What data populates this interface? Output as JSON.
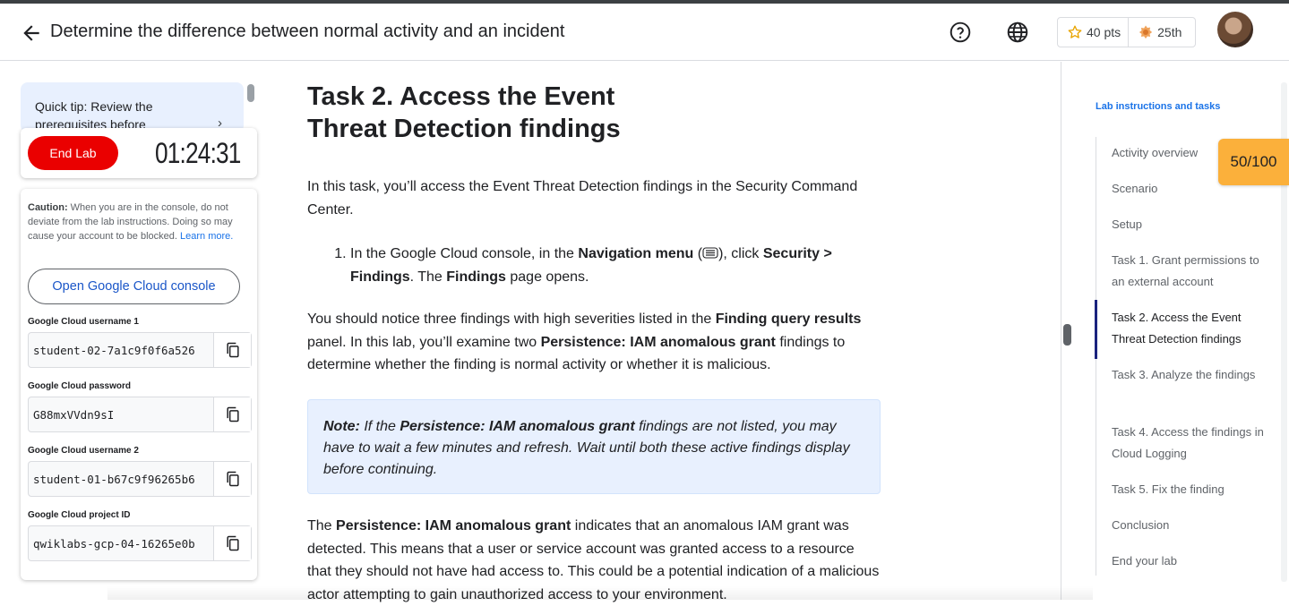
{
  "header": {
    "title": "Determine the difference between normal activity and an incident",
    "points": "40 pts",
    "rank": "25th"
  },
  "left": {
    "tip": "Quick tip: Review the prerequisites before",
    "end_lab": "End Lab",
    "timer": "01:24:31",
    "caution_label": "Caution:",
    "caution_text": " When you are in the console, do not deviate from the lab instructions. Doing so may cause your account to be blocked. ",
    "learn_more": "Learn more.",
    "open_console": "Open Google Cloud console",
    "fields": [
      {
        "label": "Google Cloud username 1",
        "value": "student-02-7a1c9f0f6a526"
      },
      {
        "label": "Google Cloud password",
        "value": "G88mxVVdn9sI"
      },
      {
        "label": "Google Cloud username 2",
        "value": "student-01-b67c9f96265b6"
      },
      {
        "label": "Google Cloud project ID",
        "value": "qwiklabs-gcp-04-16265e0b"
      }
    ]
  },
  "main": {
    "heading": "Task 2. Access the Event Threat Detection findings",
    "intro": "In this task, you’ll access the Event Threat Detection findings in the Security Command Center.",
    "step1": {
      "a": "In the Google Cloud console, in the ",
      "b": "Navigation menu",
      "c": " (",
      "d": "), click ",
      "e": "Security > Findings",
      "f": ". The ",
      "g": "Findings",
      "h": " page opens."
    },
    "para2": {
      "a": "You should notice three findings with high severities listed in the ",
      "b": "Finding query results",
      "c": " panel. In this lab, you’ll examine two ",
      "d": "Persistence: IAM anomalous grant",
      "e": " findings to determine whether the finding is normal activity or whether it is malicious."
    },
    "note": {
      "a": "Note:",
      "b": " If the ",
      "c": "Persistence: IAM anomalous grant",
      "d": " findings are not listed, you may have to wait a few minutes and refresh. Wait until both these active findings display before continuing."
    },
    "para3": {
      "a": "The ",
      "b": "Persistence: IAM anomalous grant",
      "c": " indicates that an anomalous IAM grant was detected. This means that a user or service account was granted access to a resource that they should not have had access to. This could be a potential indication of a malicious actor attempting to gain unauthorized access to your environment."
    }
  },
  "toc": {
    "heading": "Lab instructions and tasks",
    "items": [
      "Activity overview",
      "Scenario",
      "Setup",
      "Task 1. Grant permissions to an external account",
      "Task 2. Access the Event Threat Detection findings",
      "Task 3. Analyze the findings",
      "Task 4. Access the findings in Cloud Logging",
      "Task 5. Fix the finding",
      "Conclusion",
      "End your lab"
    ],
    "active_index": 4,
    "score": "50/100"
  },
  "colors": {
    "end_lab": "#ea0000",
    "accent_blue": "#1a73e8",
    "score_badge": "#fbb03b",
    "note_bg": "#e8f0fe"
  }
}
